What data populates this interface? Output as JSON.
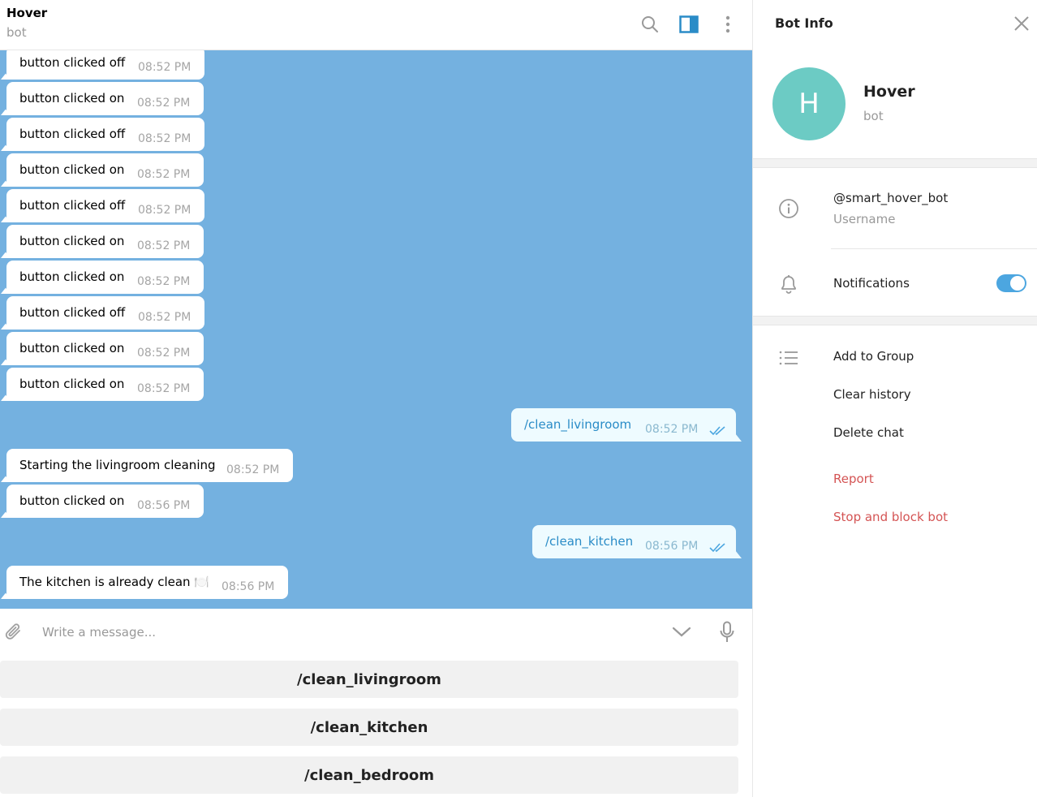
{
  "header": {
    "title": "Hover",
    "subtitle": "bot",
    "icons": [
      "search-icon",
      "sidebar-toggle-icon",
      "more-vertical-icon"
    ]
  },
  "messages": [
    {
      "dir": "in",
      "text": "button clicked off",
      "time": "08:52 PM"
    },
    {
      "dir": "in",
      "text": "button clicked on",
      "time": "08:52 PM"
    },
    {
      "dir": "in",
      "text": "button clicked off",
      "time": "08:52 PM"
    },
    {
      "dir": "in",
      "text": "button clicked on",
      "time": "08:52 PM"
    },
    {
      "dir": "in",
      "text": "button clicked off",
      "time": "08:52 PM"
    },
    {
      "dir": "in",
      "text": "button clicked on",
      "time": "08:52 PM"
    },
    {
      "dir": "in",
      "text": "button clicked on",
      "time": "08:52 PM"
    },
    {
      "dir": "in",
      "text": "button clicked off",
      "time": "08:52 PM"
    },
    {
      "dir": "in",
      "text": "button clicked on",
      "time": "08:52 PM"
    },
    {
      "dir": "in",
      "text": "button clicked on",
      "time": "08:52 PM"
    },
    {
      "dir": "out",
      "text": "/clean_livingroom",
      "time": "08:52 PM",
      "status": "read"
    },
    {
      "dir": "in",
      "text": "Starting the livingroom cleaning",
      "time": "08:52 PM"
    },
    {
      "dir": "in",
      "text": "button clicked on",
      "time": "08:56 PM"
    },
    {
      "dir": "out",
      "text": "/clean_kitchen",
      "time": "08:56 PM",
      "status": "read"
    },
    {
      "dir": "in",
      "text": "The kitchen is already clean 🍽️",
      "time": "08:56 PM"
    }
  ],
  "composer": {
    "placeholder": "Write a message...",
    "icons": [
      "attach-icon",
      "chevron-down-icon",
      "microphone-icon"
    ]
  },
  "keyboard": {
    "buttons": [
      "/clean_livingroom",
      "/clean_kitchen",
      "/clean_bedroom"
    ]
  },
  "info_panel": {
    "title": "Bot Info",
    "avatar_letter": "H",
    "avatar_color": "#6ccbc4",
    "name": "Hover",
    "subtitle": "bot",
    "username": "@smart_hover_bot",
    "username_label": "Username",
    "notifications_label": "Notifications",
    "notifications_enabled": true,
    "actions": [
      "Add to Group",
      "Clear history",
      "Delete chat"
    ],
    "danger_actions": [
      "Report",
      "Stop and block bot"
    ]
  },
  "colors": {
    "chat_background": "#74b1e0",
    "accent": "#4ca6e0",
    "danger": "#d45454",
    "outgoing_bubble": "#eefbff"
  }
}
